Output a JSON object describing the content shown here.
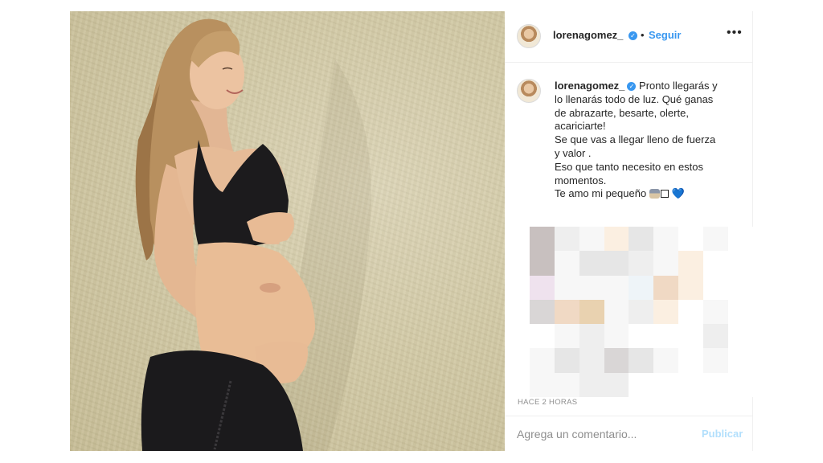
{
  "post": {
    "username": "lorenagomez_",
    "verified": true,
    "follow_label": "Seguir",
    "separator": "•",
    "more_icon": "more-horizontal-icon",
    "more_label": "•••",
    "caption_lines": [
      "Pronto llegarás y",
      "lo llenarás todo de luz. Qué ganas",
      "de abrazarte, besarte, olerte,",
      "acariciarte!",
      "Se que vas a llegar lleno de fuerza",
      "y valor .",
      "Eso que tanto necesito en estos",
      "momentos.",
      "Te amo mi pequeño"
    ],
    "caption_heart": "💙",
    "time_short": "2 h",
    "timestamp": "HACE 2 HORAS"
  },
  "comment": {
    "placeholder": "Agrega un comentario...",
    "publish_label": "Publicar"
  },
  "colors": {
    "accent": "#3897f0",
    "publish_disabled": "#b2dffc",
    "secondary_text": "#8e8e8e"
  }
}
